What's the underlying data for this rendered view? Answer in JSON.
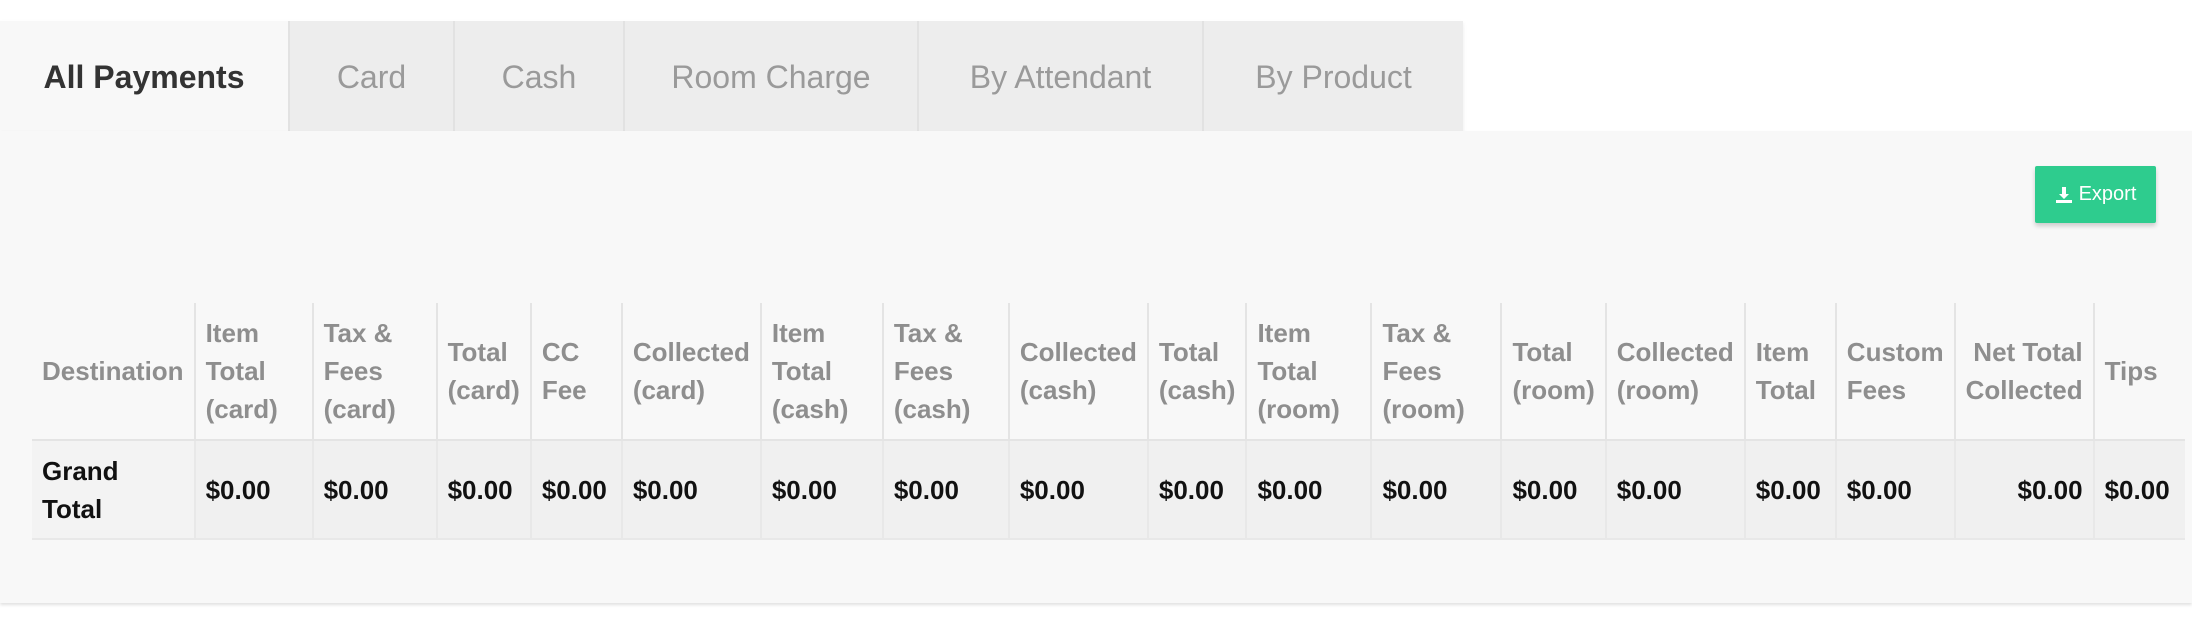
{
  "tabs": [
    {
      "label": "All Payments",
      "active": true
    },
    {
      "label": "Card",
      "active": false
    },
    {
      "label": "Cash",
      "active": false
    },
    {
      "label": "Room Charge",
      "active": false
    },
    {
      "label": "By Attendant",
      "active": false
    },
    {
      "label": "By Product",
      "active": false
    }
  ],
  "export": {
    "label": "Export",
    "icon": "download-icon",
    "color": "#2ecc8e"
  },
  "table": {
    "columns": [
      "Destination",
      "Item Total (card)",
      "Tax & Fees (card)",
      "Total (card)",
      "CC Fee",
      "Collected (card)",
      "Item Total (cash)",
      "Tax & Fees (cash)",
      "Collected (cash)",
      "Total (cash)",
      "Item Total (room)",
      "Tax & Fees (room)",
      "Total (room)",
      "Collected (room)",
      "Item Total",
      "Custom Fees",
      "Net Total Collected",
      "Tips"
    ],
    "rows": [
      {
        "cells": [
          "Grand Total",
          "$0.00",
          "$0.00",
          "$0.00",
          "$0.00",
          "$0.00",
          "$0.00",
          "$0.00",
          "$0.00",
          "$0.00",
          "$0.00",
          "$0.00",
          "$0.00",
          "$0.00",
          "$0.00",
          "$0.00",
          "$0.00",
          "$0.00"
        ]
      }
    ]
  }
}
